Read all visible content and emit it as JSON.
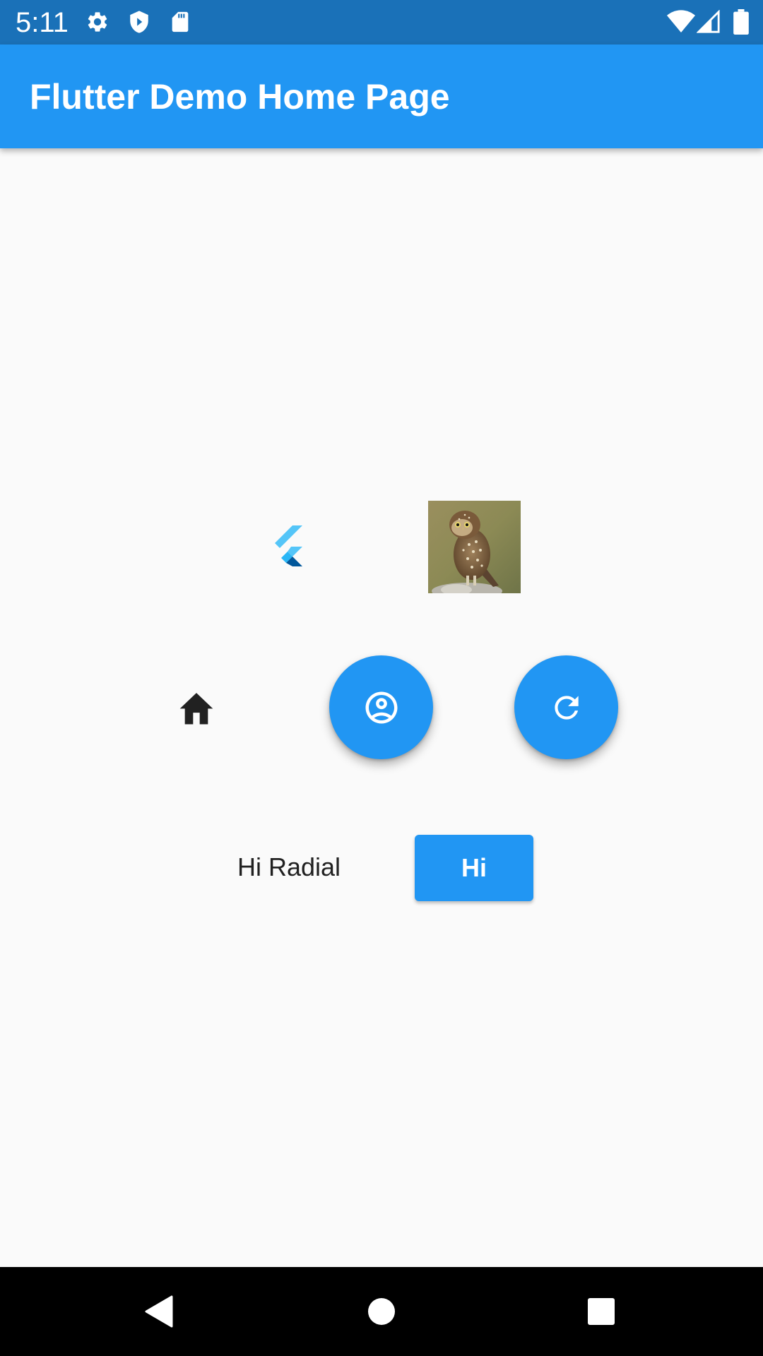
{
  "status_bar": {
    "time": "5:11",
    "left_icons": [
      "gear-icon",
      "shield-icon",
      "sd-card-icon"
    ],
    "right_icons": [
      "wifi-icon",
      "cell-signal-icon",
      "battery-icon"
    ],
    "background": "#1a71b8"
  },
  "app_bar": {
    "title": "Flutter Demo Home Page",
    "background": "#2196f3"
  },
  "content": {
    "logo_icon": "flutter-logo-icon",
    "image": "owl-photo",
    "home_icon": "home-icon",
    "fab_buttons": [
      {
        "icon": "account-circle-icon"
      },
      {
        "icon": "refresh-icon"
      }
    ],
    "label_text": "Hi Radial",
    "button_label": "Hi",
    "accent": "#2196f3"
  },
  "nav_bar": {
    "buttons": [
      "back-icon",
      "home-circle-icon",
      "recents-square-icon"
    ]
  }
}
